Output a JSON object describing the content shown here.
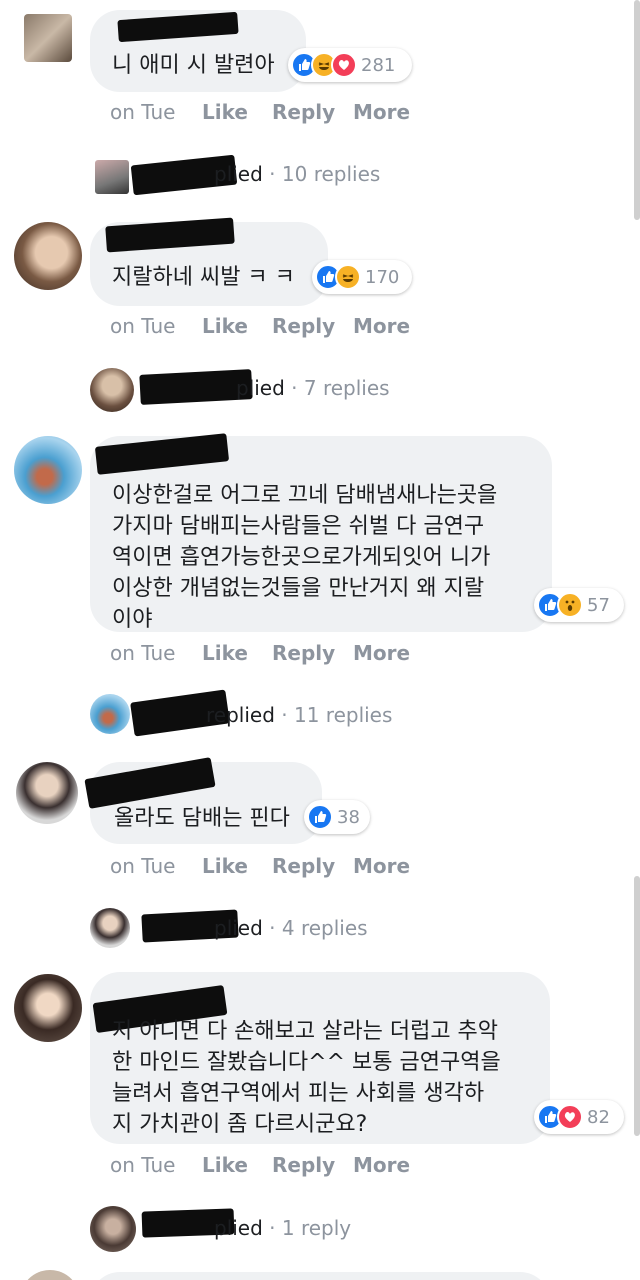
{
  "comments": [
    {
      "text": "니 애미 시 발련아",
      "reactions": [
        "like",
        "haha",
        "love"
      ],
      "reaction_count": "281",
      "time": "on Tue",
      "like_label": "Like",
      "reply_label": "Reply",
      "more_label": "More",
      "replied_text": "plied",
      "reply_count_text": "· 10 replies"
    },
    {
      "text": "지랄하네 씨발 ㅋ ㅋ",
      "reactions": [
        "like",
        "haha"
      ],
      "reaction_count": "170",
      "time": "on Tue",
      "like_label": "Like",
      "reply_label": "Reply",
      "more_label": "More",
      "replied_text": "plied",
      "reply_count_text": "· 7 replies"
    },
    {
      "text": "이상한걸로 어그로 끄네 담배냄새나는곳을\n가지마 담배피는사람들은 쉬벌 다 금연구\n역이면 흡연가능한곳으로가게되잇어 니가\n이상한 개념없는것들을 만난거지 왜 지랄\n이야",
      "reactions": [
        "like",
        "wow"
      ],
      "reaction_count": "57",
      "time": "on Tue",
      "like_label": "Like",
      "reply_label": "Reply",
      "more_label": "More",
      "replied_text": "replied",
      "reply_count_text": "· 11 replies"
    },
    {
      "text": "올라도 담배는 핀다",
      "reactions": [
        "like"
      ],
      "reaction_count": "38",
      "time": "on Tue",
      "like_label": "Like",
      "reply_label": "Reply",
      "more_label": "More",
      "replied_text": "plied",
      "reply_count_text": "· 4 replies"
    },
    {
      "text": "지 아니면 다 손해보고 살라는 더럽고 추악\n한 마인드 잘봤습니다^^ 보통 금연구역을\n늘려서 흡연구역에서 피는 사회를 생각하\n지 가치관이 좀 다르시군요?",
      "reactions": [
        "like",
        "love"
      ],
      "reaction_count": "82",
      "time": "on Tue",
      "like_label": "Like",
      "reply_label": "Reply",
      "more_label": "More",
      "replied_text": "plied",
      "reply_count_text": "· 1 reply"
    }
  ],
  "colors": {
    "like": "#1877f2",
    "love": "#f33e58",
    "haha": "#f7b125",
    "wow": "#f7b125",
    "bubble": "#eff1f3",
    "meta": "#8d949e"
  }
}
